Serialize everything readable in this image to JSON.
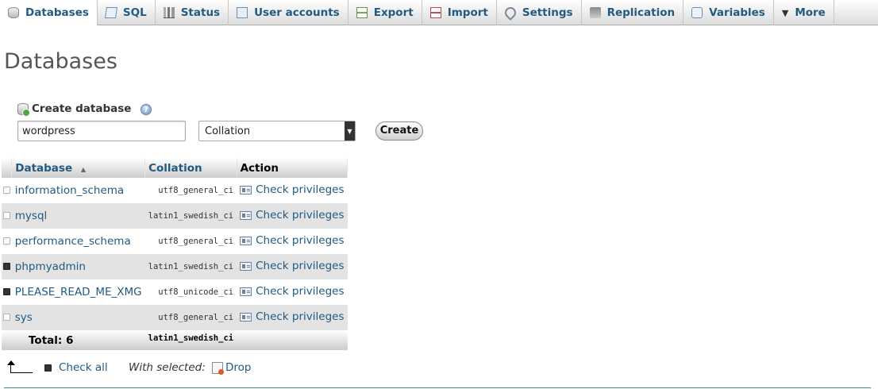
{
  "tabs": [
    {
      "label": "Databases",
      "icon": "database-icon",
      "active": true
    },
    {
      "label": "SQL",
      "icon": "sql-icon"
    },
    {
      "label": "Status",
      "icon": "status-icon"
    },
    {
      "label": "User accounts",
      "icon": "user-accounts-icon"
    },
    {
      "label": "Export",
      "icon": "export-icon"
    },
    {
      "label": "Import",
      "icon": "import-icon"
    },
    {
      "label": "Settings",
      "icon": "settings-icon"
    },
    {
      "label": "Replication",
      "icon": "replication-icon"
    },
    {
      "label": "Variables",
      "icon": "variables-icon"
    },
    {
      "label": "More",
      "icon": "chevron-down-icon"
    }
  ],
  "page": {
    "title": "Databases"
  },
  "create": {
    "label": "Create database",
    "name_value": "wordpress",
    "collation": "Collation",
    "button": "Create"
  },
  "table": {
    "headers": {
      "database": "Database",
      "collation": "Collation",
      "action": "Action"
    },
    "sort_indicator": "▲",
    "rows": [
      {
        "name": "information_schema",
        "collation": "utf8_general_ci",
        "action": "Check privileges",
        "checked": false
      },
      {
        "name": "mysql",
        "collation": "latin1_swedish_ci",
        "action": "Check privileges",
        "checked": false
      },
      {
        "name": "performance_schema",
        "collation": "utf8_general_ci",
        "action": "Check privileges",
        "checked": false
      },
      {
        "name": "phpmyadmin",
        "collation": "latin1_swedish_ci",
        "action": "Check privileges",
        "checked": true
      },
      {
        "name": "PLEASE_READ_ME_XMG",
        "collation": "utf8_unicode_ci",
        "action": "Check privileges",
        "checked": true
      },
      {
        "name": "sys",
        "collation": "utf8_general_ci",
        "action": "Check privileges",
        "checked": false
      }
    ],
    "total_label": "Total: 6",
    "total_collation": "latin1_swedish_ci"
  },
  "footer": {
    "check_all": "Check all",
    "with_selected": "With selected:",
    "drop": "Drop"
  },
  "colors": {
    "link": "#235a81",
    "row_alt": "#e3e3e3"
  }
}
